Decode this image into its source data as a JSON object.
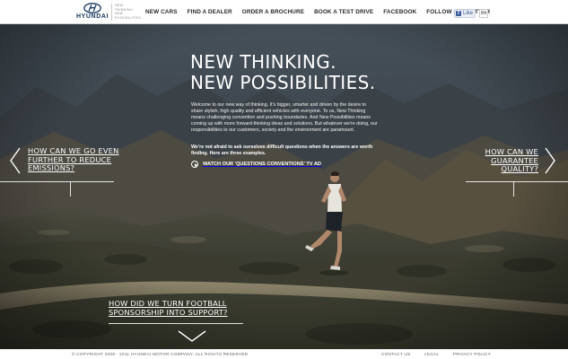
{
  "brand": {
    "logo_text": "HYUNDAI",
    "tagline": [
      "NEW",
      "THINKING.",
      "NEW",
      "POSSIBILITIES."
    ]
  },
  "nav": {
    "items": [
      {
        "label": "NEW CARS"
      },
      {
        "label": "FIND A DEALER"
      },
      {
        "label": "ORDER A BROCHURE"
      },
      {
        "label": "BOOK A TEST DRIVE"
      },
      {
        "label": "FACEBOOK"
      },
      {
        "label": "FOLLOW ON TWITTER"
      }
    ],
    "fb_like_label": "Like",
    "fb_like_count": "84"
  },
  "hero": {
    "headline": [
      "NEW THINKING.",
      "NEW POSSIBILITIES."
    ],
    "intro": "Welcome to our new way of thinking. It's bigger, smarter and driven by the desire to share stylish, high quality and efficient vehicles with everyone. To us, New Thinking means challenging convention and pushing boundaries. And New Possibilities means coming up with more forward-thinking ideas and solutions. But whatever we're doing, our responsibilities to our customers, society and the environment are paramount.",
    "intro_bold": "We're not afraid to ask ourselves difficult questions when the answers are worth finding. Here are three examples.",
    "watch_label": "WATCH OUR 'QUESTIONS CONVENTIONS' TV AD"
  },
  "questions": {
    "left": [
      "HOW CAN WE GO EVEN",
      "FURTHER TO REDUCE",
      "EMISSIONS?"
    ],
    "right": [
      "HOW CAN WE",
      "GUARANTEE",
      "QUALITY?"
    ],
    "bottom": [
      "HOW DID WE TURN FOOTBALL",
      "SPONSORSHIP INTO SUPPORT?"
    ]
  },
  "footer": {
    "copyright": "© COPYRIGHT 2008 - 2011 HYUNDAI MOTOR COMPANY. ALL RIGHTS RESERVED",
    "links": [
      {
        "label": "CONTACT US"
      },
      {
        "label": "LEGAL"
      },
      {
        "label": "PRIVACY POLICY"
      }
    ]
  },
  "colors": {
    "brand_navy": "#14375f",
    "facebook_blue": "#3b5998",
    "text_light": "#ffffff"
  },
  "icons": [
    "hyundai-emblem-icon",
    "facebook-f-icon",
    "play-circle-icon",
    "chevron-left-icon",
    "chevron-right-icon",
    "chevron-down-icon"
  ]
}
